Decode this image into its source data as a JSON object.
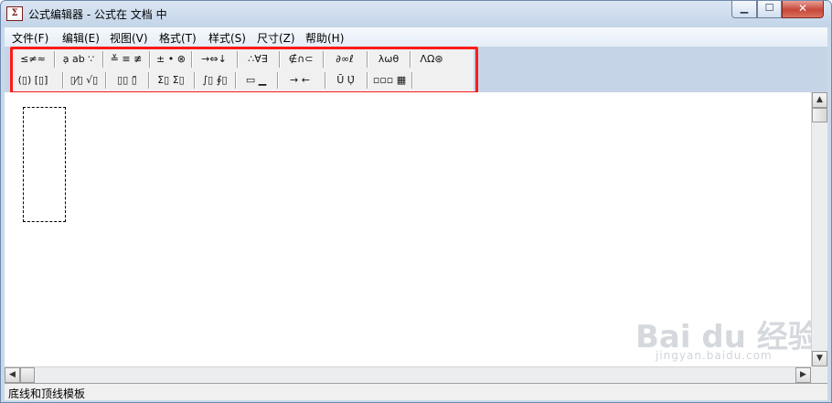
{
  "window": {
    "title": "公式编辑器 - 公式在 文档 中",
    "icon_glyph": "Σ",
    "controls": {
      "minimize": "▁",
      "maximize": "☐",
      "close": "✕"
    }
  },
  "menu": [
    "文件(F)",
    "编辑(E)",
    "视图(V)",
    "格式(T)",
    "样式(S)",
    "尺寸(Z)",
    "帮助(H)"
  ],
  "toolbar": {
    "row1": [
      "≤≠≈",
      "ạ ab ∵",
      "≚ ≡ ≢",
      "± • ⊗",
      "→⇔↓",
      "∴∀∃",
      "∉∩⊂",
      "∂∞ℓ",
      "λωθ",
      "ΛΩ⊛"
    ],
    "row2": [
      "(▯) [▯]",
      "▯⁄▯ √▯",
      "▯▯ ▯̄",
      "Σ▯ Σ▯",
      "∫▯ ∮▯",
      "▭ ▁",
      "→ ←",
      "Ū Ụ̇",
      "▫▫▫ ▦"
    ]
  },
  "watermark": {
    "text": "Bai du 经验",
    "sub": "jingyan.baidu.com"
  },
  "status": "底线和顶线模板",
  "scroll_icons": {
    "up": "▲",
    "down": "▼",
    "left": "◀",
    "right": "▶"
  }
}
